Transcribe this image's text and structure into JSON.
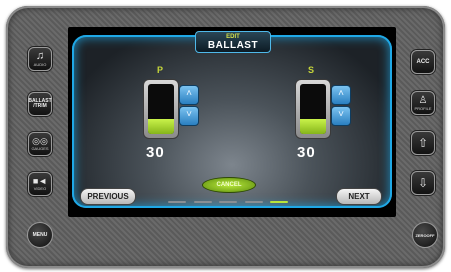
{
  "screen": {
    "title_sub": "EDIT",
    "title_main": "BALLAST",
    "tanks": [
      {
        "label": "P",
        "value": "30",
        "level_percent": 30
      },
      {
        "label": "S",
        "value": "30",
        "level_percent": 30
      }
    ],
    "buttons": {
      "previous": "PREVIOUS",
      "cancel": "CANCEL",
      "next": "NEXT"
    },
    "pager": {
      "pages": 5,
      "active": 5
    }
  },
  "left_buttons": {
    "audio": "AUDIO",
    "ballast": "BALLAST",
    "trim": "/TRIM",
    "gauges": "GAUGES",
    "video": "VIDEO",
    "menu": "MENU"
  },
  "right_buttons": {
    "acc": "ACC",
    "profile": "PROFILE",
    "zero_off": "ZEROOFF"
  },
  "icons": {
    "audio": "music-note-icon",
    "gauges": "gauge-icon",
    "video": "camera-icon",
    "profile": "profile-icon",
    "up": "arrow-up-icon",
    "down": "arrow-down-icon"
  }
}
